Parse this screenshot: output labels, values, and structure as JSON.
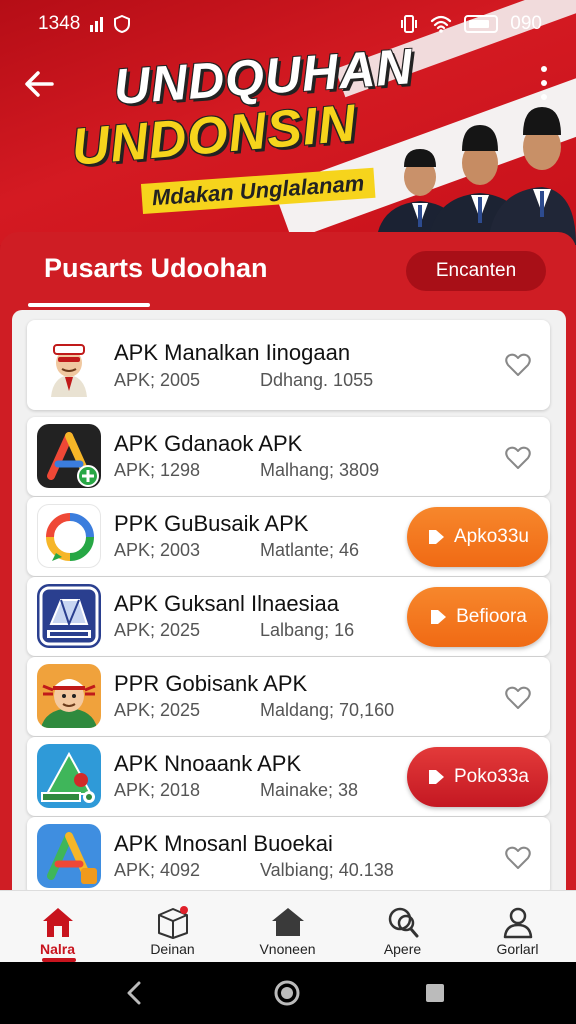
{
  "status_bar": {
    "time": "1348",
    "right_text": "090"
  },
  "banner": {
    "title_line1": "UNDQUHAN",
    "title_line2": "UNDONSIN",
    "subtitle": "Mdakan Unglalanam"
  },
  "section": {
    "title": "Pusarts Udoohan",
    "filter_label": "Encanten"
  },
  "apps": [
    {
      "name": "APK Manalkan Iinogaan",
      "meta1": "APK; 2005",
      "meta2": "Ddhang. 1055",
      "action": "heart"
    },
    {
      "name": "APK Gdanaok APK",
      "meta1": "APK; 1298",
      "meta2": "Malhang; 3809",
      "action": "heart"
    },
    {
      "name": "PPK GuBusaik APK",
      "meta1": "APK; 2003",
      "meta2": "Matlante; 46",
      "action": "button",
      "button_label": "Apko33u",
      "button_color": "#f17016"
    },
    {
      "name": "APK Guksanl Ilnaesiaa",
      "meta1": "APK; 2025",
      "meta2": "Lalbang; 16",
      "action": "button",
      "button_label": "Befioora",
      "button_color": "#f17016"
    },
    {
      "name": "PPR Gobisank APK",
      "meta1": "APK; 2025",
      "meta2": "Maldang; 70,160",
      "action": "heart"
    },
    {
      "name": "APK Nnoaank APK",
      "meta1": "APK; 2018",
      "meta2": "Mainake; 38",
      "action": "button",
      "button_label": "Poko33a",
      "button_color": "#d2242c"
    },
    {
      "name": "APK Mnosanl Buoekai",
      "meta1": "APK; 4092",
      "meta2": "Valbiang; 40.138",
      "action": "heart"
    }
  ],
  "bottom_nav": [
    {
      "label": "Nalra",
      "icon": "home-icon",
      "active": true
    },
    {
      "label": "Deinan",
      "icon": "package-icon",
      "active": false
    },
    {
      "label": "Vnoneen",
      "icon": "house-icon",
      "active": false
    },
    {
      "label": "Apere",
      "icon": "search-icon",
      "active": false
    },
    {
      "label": "Gorlarl",
      "icon": "profile-icon",
      "active": false
    }
  ],
  "colors": {
    "brand_red": "#c8141e",
    "accent_yellow": "#f6d41c",
    "orange": "#f17016"
  }
}
